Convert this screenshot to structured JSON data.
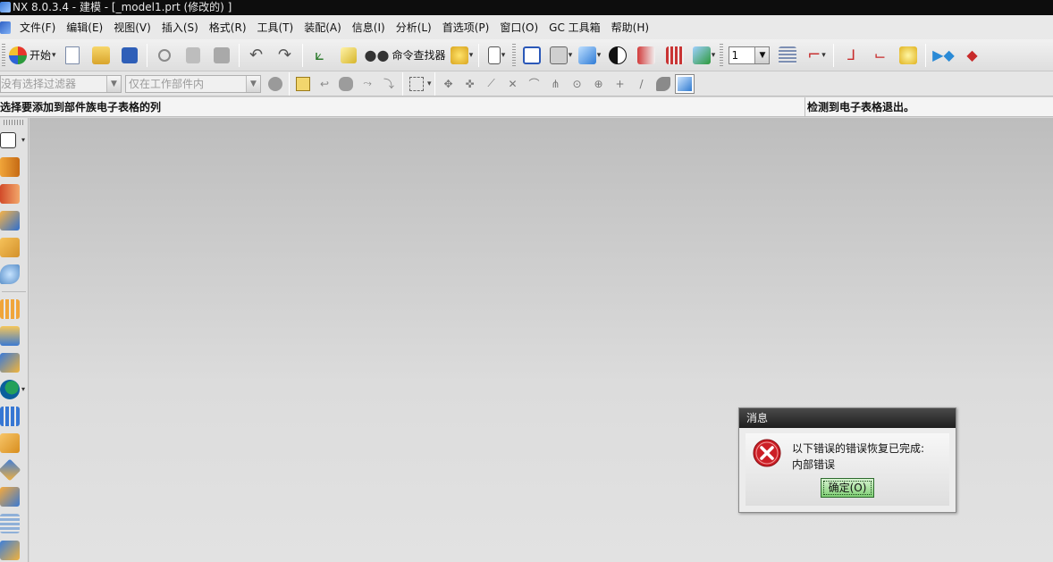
{
  "window": {
    "title": "NX 8.0.3.4 - 建模 - [_model1.prt  (修改的) ]"
  },
  "menu": {
    "items": [
      "文件(F)",
      "编辑(E)",
      "视图(V)",
      "插入(S)",
      "格式(R)",
      "工具(T)",
      "装配(A)",
      "信息(I)",
      "分析(L)",
      "首选项(P)",
      "窗口(O)",
      "GC 工具箱",
      "帮助(H)"
    ]
  },
  "toolbar": {
    "start_label": "开始",
    "command_finder_label": "命令查找器",
    "layer_value": "1"
  },
  "selection_bar": {
    "filter_text": "没有选择过滤器",
    "scope_text": "仅在工作部件内"
  },
  "status": {
    "left": "选择要添加到部件族电子表格的列",
    "right": "检测到电子表格退出。"
  },
  "dialog": {
    "title": "消息",
    "line1": "以下错误的错误恢复已完成:",
    "line2": "内部错误",
    "ok_label": "确定(O)"
  },
  "colors": {
    "titlebar": "#0d0d0d",
    "dialog_header": "#2a2a2a",
    "ok_button": "#8fd585",
    "error_red": "#cc1f26"
  }
}
